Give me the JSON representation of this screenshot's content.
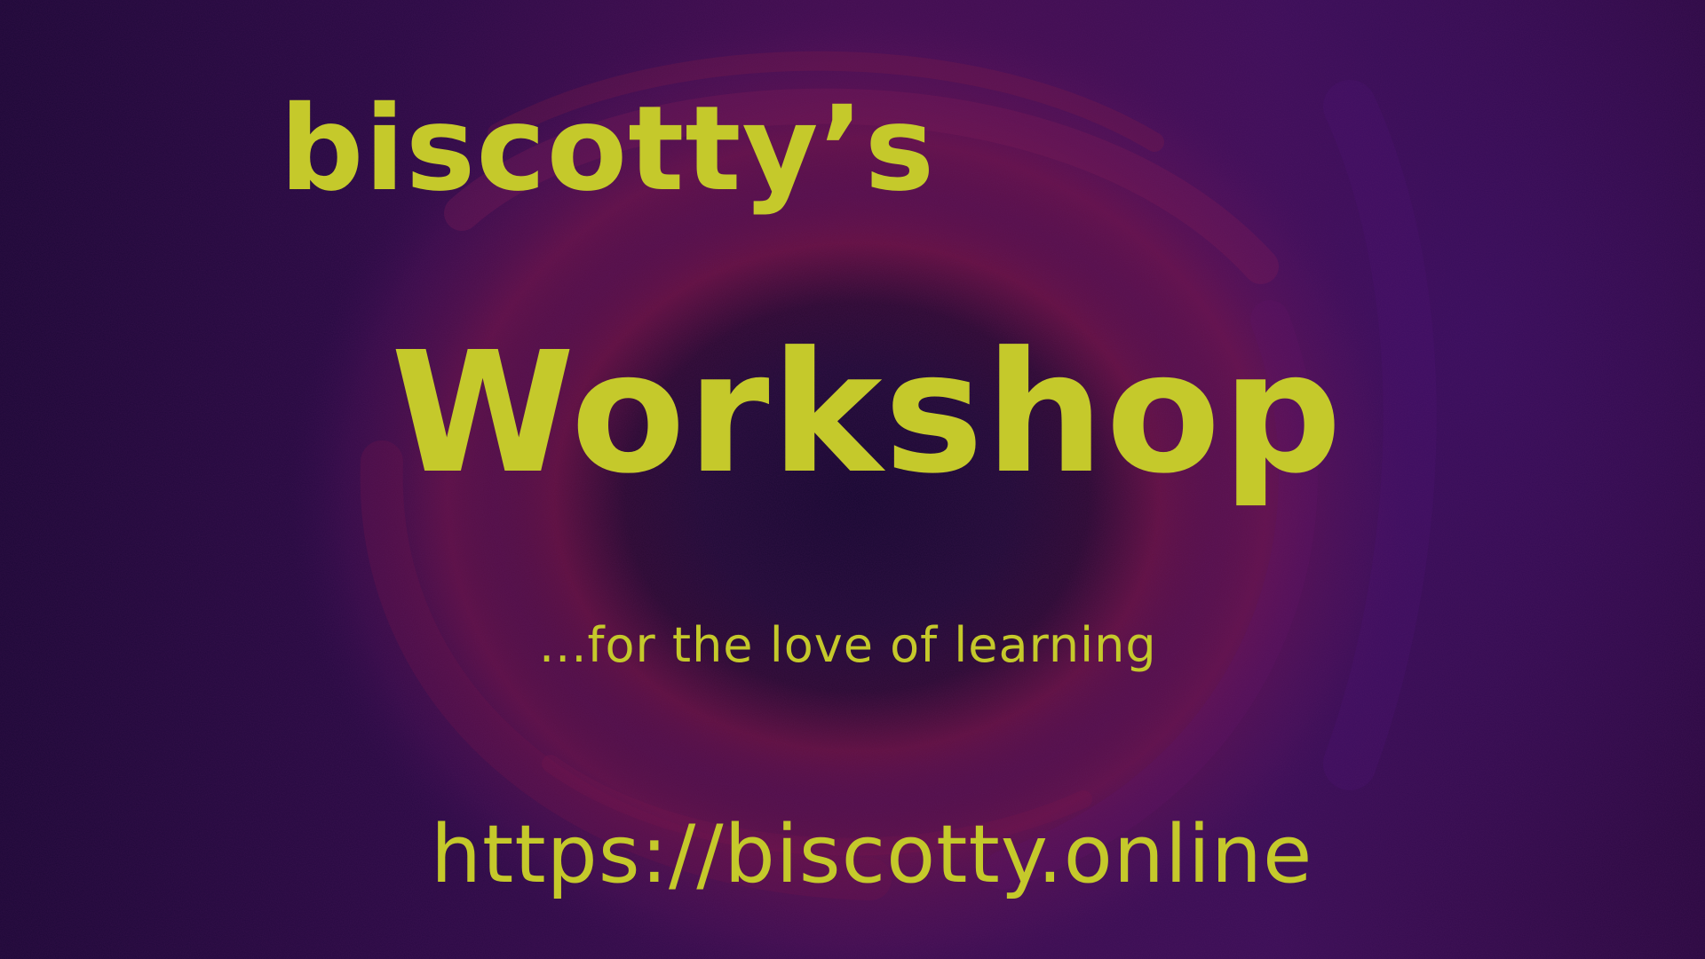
{
  "colors": {
    "text": "#c5c92b",
    "background_dark": "#1c0836",
    "background_purple": "#3a0d4e",
    "background_red": "#6e123c"
  },
  "title": {
    "small": "biscotty’s",
    "large": "Workshop"
  },
  "tagline": "...for the love of learning",
  "url": "https://biscotty.online"
}
